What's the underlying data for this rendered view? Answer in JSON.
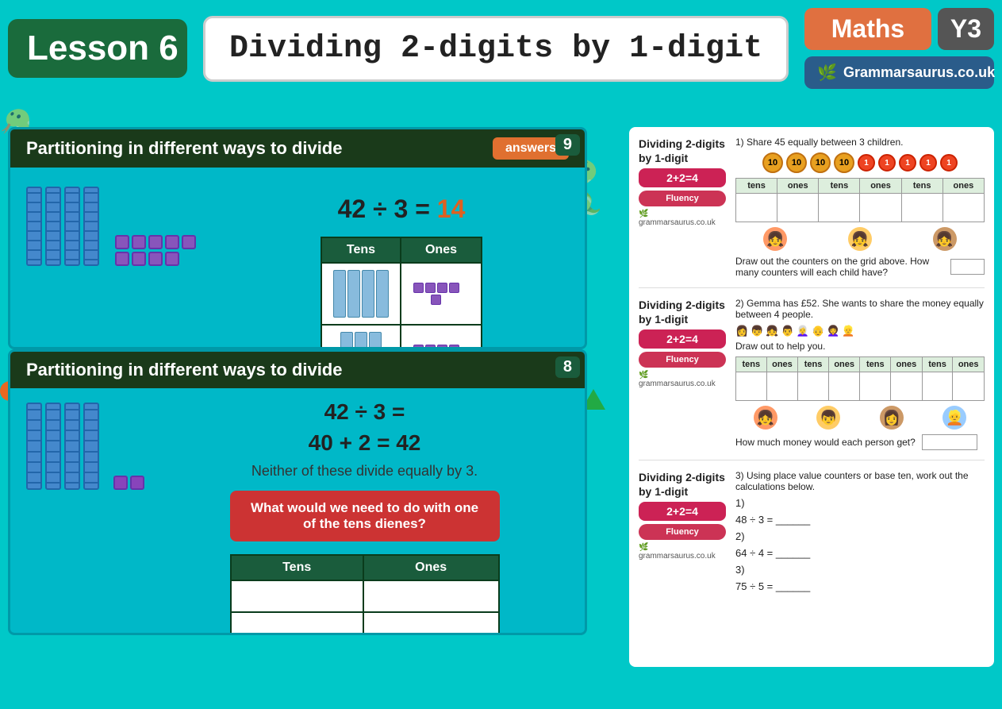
{
  "header": {
    "lesson_label": "Lesson 6",
    "title": "Dividing 2-digits by 1-digit",
    "maths_label": "Maths",
    "year_label": "Y3",
    "grammarsaurus_label": "Grammarsaurus.co.uk"
  },
  "slide9": {
    "number": "9",
    "header_text": "Partitioning in different ways to divide",
    "answers_btn": "answers",
    "equation": "42 ÷ 3 = ",
    "answer": "14",
    "table_headers": [
      "Tens",
      "Ones"
    ]
  },
  "slide8": {
    "number": "8",
    "header_text": "Partitioning in different ways to divide",
    "equation_line1": "42 ÷ 3 =",
    "equation_line2": "40 + 2 = 42",
    "note": "Neither of these divide equally by 3.",
    "question_btn": "What would we need to do with one of the tens dienes?",
    "table_headers": [
      "Tens",
      "Ones"
    ]
  },
  "worksheet": {
    "section1": {
      "title": "Dividing 2-digits by 1-digit",
      "badge": "2+2=4",
      "fluency": "Fluency",
      "question": "1) Share 45 equally between 3 children.",
      "counters_tens": [
        "10",
        "10",
        "10",
        "10"
      ],
      "counters_ones": [
        "1",
        "1",
        "1",
        "1",
        "1"
      ],
      "grid_headers": [
        "tens",
        "ones",
        "tens",
        "ones",
        "tens",
        "ones"
      ],
      "sub_question": "Draw out the counters on the grid above. How many counters will each child have?",
      "answer_label": ""
    },
    "section2": {
      "title": "Dividing 2-digits by 1-digit",
      "badge": "2+2=4",
      "fluency": "Fluency",
      "question": "2) Gemma has £52. She wants to share the money equally between 4 people.",
      "sub_question": "Draw out to help you.",
      "grid_headers": [
        "tens",
        "ones",
        "tens",
        "ones",
        "tens",
        "ones",
        "tens",
        "ones"
      ],
      "answer_label": "How much money would each person get?"
    },
    "section3": {
      "title": "Dividing 2-digits by 1-digit",
      "badge": "2+2=4",
      "fluency": "Fluency",
      "question": "3) Using place value counters or base ten, work out the calculations below.",
      "calc1": "48 ÷ 3 = ______",
      "calc2": "64 ÷ 4 = ______",
      "calc3": "75 ÷ 5 = ______"
    }
  }
}
